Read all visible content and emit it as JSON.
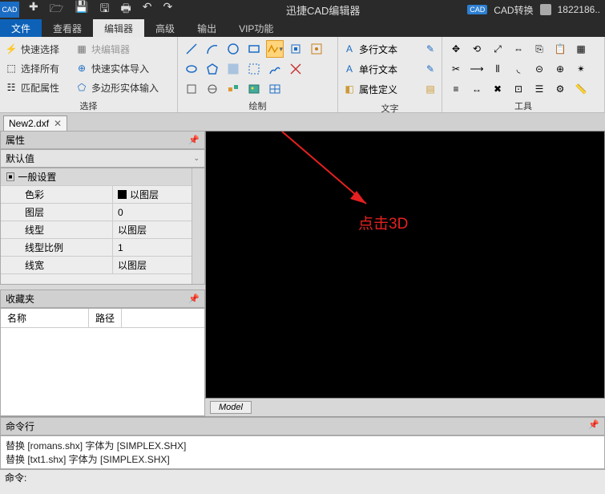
{
  "title": "迅捷CAD编辑器",
  "titleRight": {
    "convert": "CAD转换",
    "user": "1822186.."
  },
  "menu": {
    "file": "文件",
    "viewer": "查看器",
    "editor": "编辑器",
    "advanced": "高级",
    "output": "输出",
    "vip": "VIP功能"
  },
  "ribbon": {
    "select": {
      "quickSelect": "快速选择",
      "blockEditor": "块编辑器",
      "selectAll": "选择所有",
      "quickImport": "快速实体导入",
      "matchProps": "匹配属性",
      "polyImport": "多边形实体输入",
      "label": "选择"
    },
    "draw": {
      "label": "绘制"
    },
    "text": {
      "multiText": "多行文本",
      "singleText": "单行文本",
      "attrDef": "属性定义",
      "label": "文字"
    },
    "tools": {
      "label": "工具"
    }
  },
  "fileTab": "New2.dxf",
  "propPanel": {
    "title": "属性",
    "default": "默认值",
    "general": "一般设置",
    "rows": {
      "color": {
        "k": "色彩",
        "v": "以图层"
      },
      "layer": {
        "k": "图层",
        "v": "0"
      },
      "ltype": {
        "k": "线型",
        "v": "以图层"
      },
      "lscale": {
        "k": "线型比例",
        "v": "1"
      },
      "lweight": {
        "k": "线宽",
        "v": "以图层"
      }
    }
  },
  "favPanel": {
    "title": "收藏夹",
    "name": "名称",
    "path": "路径"
  },
  "annotation": "点击3D",
  "modelTab": "Model",
  "cmd": {
    "title": "命令行",
    "line1": "替换 [romans.shx] 字体为 [SIMPLEX.SHX]",
    "line2": "替换 [txt1.shx] 字体为 [SIMPLEX.SHX]",
    "prompt": "命令:"
  }
}
